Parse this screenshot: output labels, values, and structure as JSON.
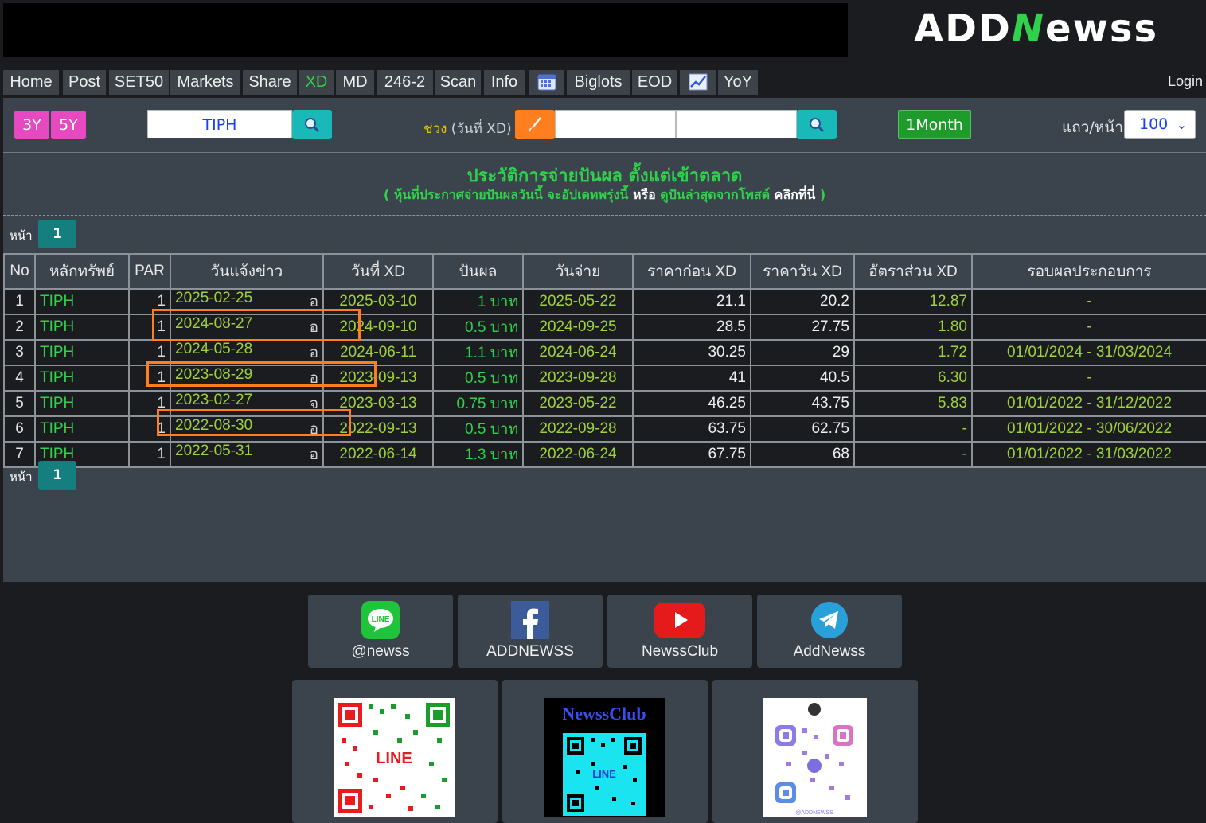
{
  "logo": {
    "left": "ADD",
    "mid": "N",
    "right": "ewss"
  },
  "nav": {
    "items": [
      "Home",
      "Post",
      "SET50",
      "Markets",
      "Share",
      "XD",
      "MD",
      "246-2",
      "Scan",
      "Info",
      "",
      "Biglots",
      "EOD",
      "",
      "YoY"
    ],
    "active": "XD",
    "login": "Login"
  },
  "toolbar": {
    "btn_3y": "3Y",
    "btn_5y": "5Y",
    "symbol": "TIPH",
    "range_label_highlight": "ช่วง",
    "range_label_rest": " (วันที่ XD)",
    "date_from": "",
    "date_to": "",
    "month_button": "1Month",
    "rows_label": "แถว/หน้า",
    "rows_value": "100"
  },
  "heading": "ประวัติการจ่ายปันผล ตั้งแต่เข้าตลาด",
  "subheading": {
    "part1": "( หุ้นที่ประกาศจ่ายปันผลวันนี้ จะอัปเดทพรุ่งนี้ ",
    "part2": "หรือ",
    "part3": " ดูปันล่าสุดจากโพสต์ ",
    "part4": "คลิกที่นี่",
    "part5": " )"
  },
  "pagination": {
    "label": "หน้า",
    "page": "1"
  },
  "table": {
    "headers": [
      "No",
      "หลักทรัพย์",
      "PAR",
      "วันแจ้งข่าว",
      "วันที่ XD",
      "ปันผล",
      "วันจ่าย",
      "ราคาก่อน XD",
      "ราคาวัน XD",
      "อัตราส่วน XD",
      "รอบผลประกอบการ"
    ],
    "rows": [
      {
        "no": "1",
        "sym": "TIPH",
        "par": "1",
        "ann": "2025-02-25",
        "k": "อ",
        "xd": "2025-03-10",
        "div": "1 บาท",
        "pay": "2025-05-22",
        "before": "21.1",
        "on": "20.2",
        "ratio": "12.87",
        "period": "-"
      },
      {
        "no": "2",
        "sym": "TIPH",
        "par": "1",
        "ann": "2024-08-27",
        "k": "อ",
        "xd": "2024-09-10",
        "div": "0.5 บาท",
        "pay": "2024-09-25",
        "before": "28.5",
        "on": "27.75",
        "ratio": "1.80",
        "period": "-"
      },
      {
        "no": "3",
        "sym": "TIPH",
        "par": "1",
        "ann": "2024-05-28",
        "k": "อ",
        "xd": "2024-06-11",
        "div": "1.1 บาท",
        "pay": "2024-06-24",
        "before": "30.25",
        "on": "29",
        "ratio": "1.72",
        "period": "01/01/2024 - 31/03/2024"
      },
      {
        "no": "4",
        "sym": "TIPH",
        "par": "1",
        "ann": "2023-08-29",
        "k": "อ",
        "xd": "2023-09-13",
        "div": "0.5 บาท",
        "pay": "2023-09-28",
        "before": "41",
        "on": "40.5",
        "ratio": "6.30",
        "period": "-"
      },
      {
        "no": "5",
        "sym": "TIPH",
        "par": "1",
        "ann": "2023-02-27",
        "k": "จ",
        "xd": "2023-03-13",
        "div": "0.75 บาท",
        "pay": "2023-05-22",
        "before": "46.25",
        "on": "43.75",
        "ratio": "5.83",
        "period": "01/01/2022 - 31/12/2022"
      },
      {
        "no": "6",
        "sym": "TIPH",
        "par": "1",
        "ann": "2022-08-30",
        "k": "อ",
        "xd": "2022-09-13",
        "div": "0.5 บาท",
        "pay": "2022-09-28",
        "before": "63.75",
        "on": "62.75",
        "ratio": "-",
        "period": "01/01/2022 - 30/06/2022"
      },
      {
        "no": "7",
        "sym": "TIPH",
        "par": "1",
        "ann": "2022-05-31",
        "k": "อ",
        "xd": "2022-06-14",
        "div": "1.3 บาท",
        "pay": "2022-06-24",
        "before": "67.75",
        "on": "68",
        "ratio": "-",
        "period": "01/01/2022 - 31/03/2022"
      }
    ]
  },
  "social": [
    {
      "label": "@newss",
      "icon": "line-icon",
      "color": "#1fc43a"
    },
    {
      "label": "ADDNEWSS",
      "icon": "facebook-icon",
      "color": "#3b5b9a"
    },
    {
      "label": "NewssClub",
      "icon": "youtube-icon",
      "color": "#e51b1b"
    },
    {
      "label": "AddNewss",
      "icon": "telegram-icon",
      "color": "#2aa0d8"
    }
  ],
  "qr_cards": {
    "newssclub_title": "NewssClub",
    "line_label": "LINE",
    "handle": "@ADDNEWSS"
  },
  "colors": {
    "accent_green": "#2fd24a",
    "date_green": "#9fd13b",
    "highlight": "#ff7f1e",
    "panel": "#3b444d"
  }
}
